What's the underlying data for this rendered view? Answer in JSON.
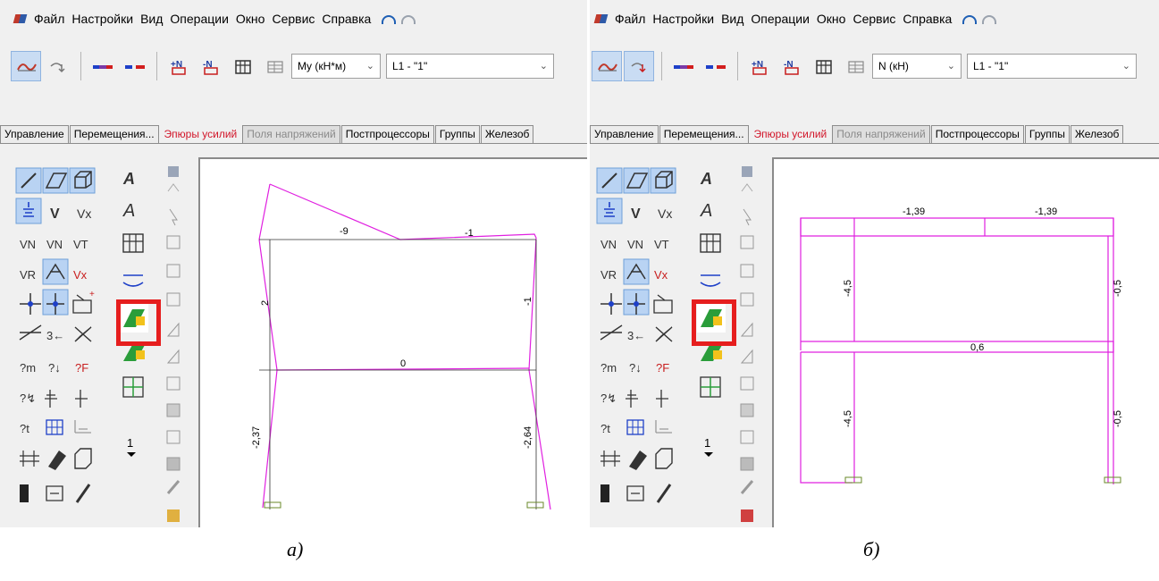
{
  "menu": {
    "file": "Файл",
    "settings": "Настройки",
    "view": "Вид",
    "operations": "Операции",
    "window": "Окно",
    "service": "Сервис",
    "help": "Справка"
  },
  "tabs": {
    "a": [
      "Управление",
      "Перемещения...",
      "Эпюры усилий",
      "Поля напряжений",
      "Постпроцессоры",
      "Группы",
      "Железоб"
    ],
    "b": [
      "Управление",
      "Перемещения...",
      "Эпюры усилий",
      "Поля напряжений",
      "Постпроцессоры",
      "Группы",
      "Железоб"
    ]
  },
  "panel_a": {
    "force_combo": "My (кН*м)",
    "load_combo": "L1 - \"1\"",
    "spinner": "1",
    "diagram_labels": [
      "-9",
      "-1",
      "2",
      "-1",
      "0",
      "-2,37",
      "-2,64"
    ],
    "caption": "а)"
  },
  "panel_b": {
    "force_combo": "N (кН)",
    "load_combo": "L1 - \"1\"",
    "spinner": "1",
    "diagram_labels": [
      "-1,39",
      "-1,39",
      "-4,5",
      "-0,5",
      "0,6",
      "-4,5",
      "-0,5"
    ],
    "caption": "б)"
  },
  "colors": {
    "diagram": "#e020e0",
    "active_tab": "#d2162a",
    "highlight": "#e61e1e",
    "support": "#6a8a2a"
  }
}
